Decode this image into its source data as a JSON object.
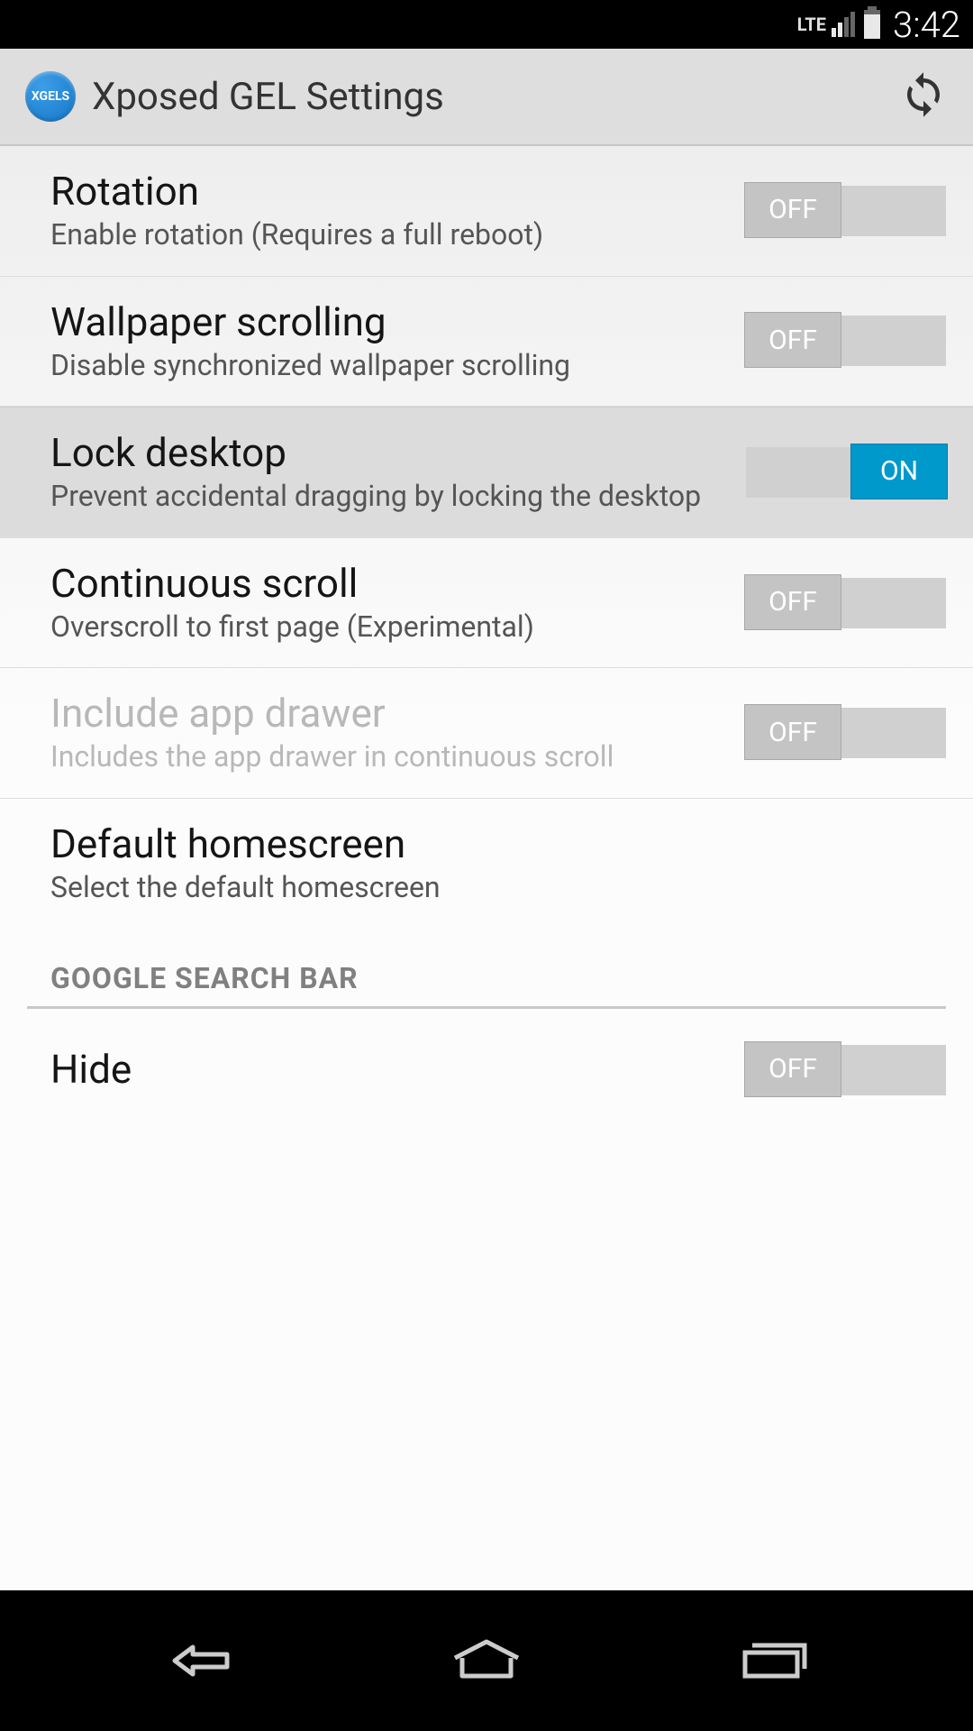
{
  "status_bar": {
    "network": "LTE",
    "time": "3:42"
  },
  "action_bar": {
    "app_icon_label": "XGELS",
    "title": "Xposed GEL Settings"
  },
  "settings": {
    "items": [
      {
        "title": "Rotation",
        "subtitle": "Enable rotation (Requires a full reboot)",
        "has_toggle": true,
        "toggle_state": "OFF",
        "disabled": false,
        "selected": false
      },
      {
        "title": "Wallpaper scrolling",
        "subtitle": "Disable synchronized wallpaper scrolling",
        "has_toggle": true,
        "toggle_state": "OFF",
        "disabled": false,
        "selected": false
      },
      {
        "title": "Lock desktop",
        "subtitle": "Prevent accidental dragging by locking the desktop",
        "has_toggle": true,
        "toggle_state": "ON",
        "disabled": false,
        "selected": true
      },
      {
        "title": "Continuous scroll",
        "subtitle": "Overscroll to first page (Experimental)",
        "has_toggle": true,
        "toggle_state": "OFF",
        "disabled": false,
        "selected": false
      },
      {
        "title": "Include app drawer",
        "subtitle": "Includes the app drawer in continuous scroll",
        "has_toggle": true,
        "toggle_state": "OFF",
        "disabled": true,
        "selected": false
      },
      {
        "title": "Default homescreen",
        "subtitle": "Select the default homescreen",
        "has_toggle": false,
        "disabled": false,
        "selected": false
      }
    ]
  },
  "section_header": "GOOGLE SEARCH BAR",
  "section_items": [
    {
      "title": "Hide",
      "toggle_state": "OFF"
    }
  ],
  "toggle_labels": {
    "on": "ON",
    "off": "OFF"
  }
}
